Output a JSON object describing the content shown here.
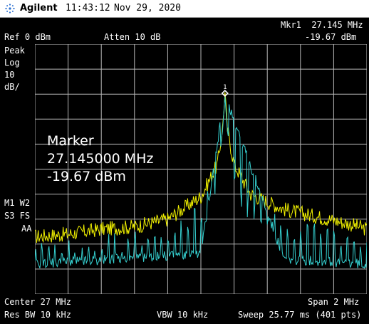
{
  "header": {
    "brand": "Agilent",
    "time": "11:43:12",
    "date": "Nov 29, 2020"
  },
  "status": {
    "marker_line": "Mkr1  27.145 MHz",
    "marker_level": "-19.67 dBm",
    "ref_level": "Ref 0 dBm",
    "atten": "Atten 10 dB",
    "detector": "Peak",
    "scale_type": "Log",
    "scale_value": "10",
    "scale_unit": "dB/",
    "trace_m1w2": "M1 W2",
    "trace_s3fs": "S3 FS",
    "trace_aa": "AA"
  },
  "marker_box": {
    "title": "Marker",
    "frequency": "27.145000 MHz",
    "amplitude": "-19.67 dBm"
  },
  "marker_flag": "1",
  "footer": {
    "center": "Center 27 MHz",
    "span": "Span 2 MHz",
    "res_bw": "Res BW 10 kHz",
    "vbw": "VBW 10 kHz",
    "sweep": "Sweep 25.77 ms (401 pts)"
  },
  "colors": {
    "background": "#000000",
    "grid": "#b8b8b8",
    "trace_max_hold": "#f2f200",
    "trace_live": "#35d0d0",
    "marker": "#ffffff"
  },
  "chart_data": {
    "type": "line",
    "x_unit": "MHz",
    "xlim": [
      26,
      28
    ],
    "y_unit": "dBm",
    "ylim": [
      -100,
      0
    ],
    "y_scale": "log 10 dB/div",
    "grid": true,
    "points": 401,
    "marker": {
      "x": 27.145,
      "y": -19.67
    },
    "series": [
      {
        "id": "max-hold",
        "color": "#f2f200",
        "profile": [
          [
            26.0,
            -77
          ],
          [
            26.2,
            -76
          ],
          [
            26.4,
            -74
          ],
          [
            26.6,
            -73
          ],
          [
            26.8,
            -70
          ],
          [
            27.0,
            -61
          ],
          [
            27.1,
            -48
          ],
          [
            27.13,
            -34
          ],
          [
            27.145,
            -19.67
          ],
          [
            27.16,
            -34
          ],
          [
            27.2,
            -48
          ],
          [
            27.3,
            -60
          ],
          [
            27.5,
            -66
          ],
          [
            27.7,
            -69
          ],
          [
            27.9,
            -72
          ],
          [
            28.0,
            -74
          ]
        ]
      },
      {
        "id": "live",
        "color": "#35d0d0",
        "profile": [
          [
            26.0,
            -88
          ],
          [
            26.5,
            -86
          ],
          [
            27.0,
            -84
          ],
          [
            27.145,
            -20
          ],
          [
            27.5,
            -86
          ],
          [
            28.0,
            -88
          ]
        ]
      }
    ]
  }
}
